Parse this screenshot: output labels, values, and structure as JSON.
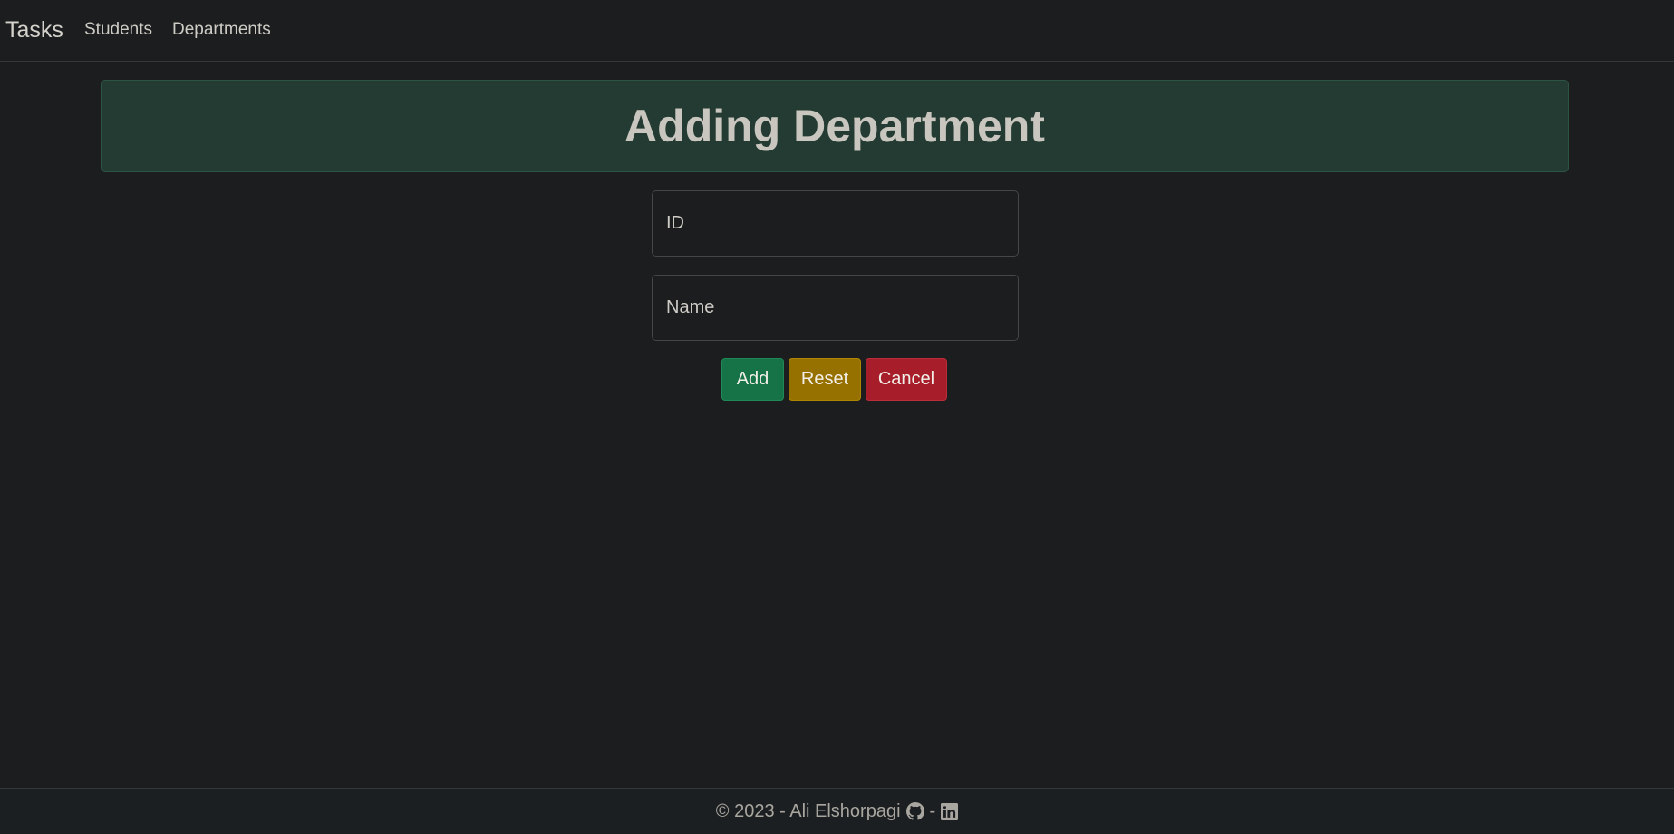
{
  "navbar": {
    "brand": "Tasks",
    "links": [
      "Students",
      "Departments"
    ]
  },
  "page": {
    "title": "Adding Department"
  },
  "form": {
    "id_placeholder": "ID",
    "name_placeholder": "Name",
    "buttons": {
      "add": "Add",
      "reset": "Reset",
      "cancel": "Cancel"
    }
  },
  "footer": {
    "copyright": "© 2023 - Ali Elshorpagi",
    "separator": "-",
    "icons": [
      "github-icon",
      "linkedin-icon"
    ]
  },
  "colors": {
    "background": "#1b1d1f",
    "title_bg": "#233b32",
    "add": "#157347",
    "reset": "#977100",
    "cancel": "#a71d2a"
  }
}
